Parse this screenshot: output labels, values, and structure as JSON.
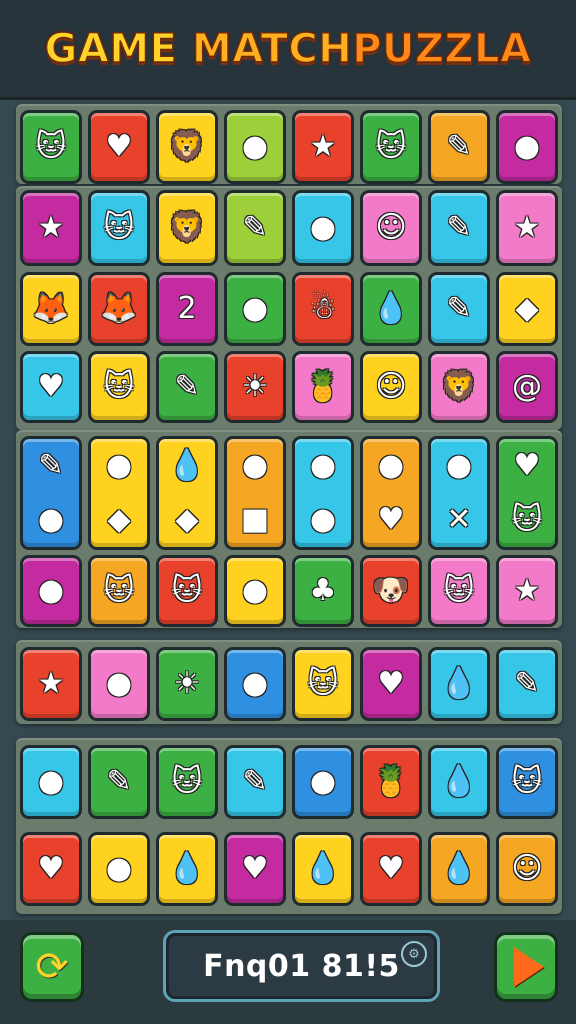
{
  "header": {
    "title_part1": "GAME",
    "title_part2": "MATCH",
    "title_part3": "PUZZLA"
  },
  "colors": {
    "green": "#3cb043",
    "red": "#e8412c",
    "orange": "#f5a623",
    "yellow": "#ffd21f",
    "cyan": "#35c6e8",
    "blue": "#2f8fe0",
    "pink": "#f27ac8",
    "magenta": "#c42ba0",
    "white": "#eef2f0",
    "lime": "#9ccf3a"
  },
  "rows": [
    {
      "tiles": [
        {
          "color": "green",
          "icon": "cat-face-icon",
          "glyph": "🐱"
        },
        {
          "color": "red",
          "icon": "heart-icon",
          "glyph": "♥"
        },
        {
          "color": "yellow",
          "icon": "lion-face-icon",
          "glyph": "🦁"
        },
        {
          "color": "lime",
          "icon": "green-blob-icon",
          "glyph": "●"
        },
        {
          "color": "red",
          "icon": "star-face-icon",
          "glyph": "★"
        },
        {
          "color": "green",
          "icon": "purple-cat-icon",
          "glyph": "🐱"
        },
        {
          "color": "orange",
          "icon": "pencil-icon",
          "glyph": "✎"
        },
        {
          "color": "magenta",
          "icon": "blue-blob-icon",
          "glyph": "●"
        }
      ]
    },
    {
      "tiles": [
        {
          "color": "magenta",
          "icon": "star-face-icon",
          "glyph": "★"
        },
        {
          "color": "cyan",
          "icon": "pink-cat-icon",
          "glyph": "🐱"
        },
        {
          "color": "yellow",
          "icon": "lion-face-icon",
          "glyph": "🦁"
        },
        {
          "color": "lime",
          "icon": "pencil-icon",
          "glyph": "✎"
        },
        {
          "color": "cyan",
          "icon": "lollipop-icon",
          "glyph": "●"
        },
        {
          "color": "pink",
          "icon": "face-with-hat-icon",
          "glyph": "☺"
        },
        {
          "color": "cyan",
          "icon": "pencil-icon",
          "glyph": "✎"
        },
        {
          "color": "pink",
          "icon": "star-face-icon",
          "glyph": "★"
        }
      ]
    },
    {
      "tiles": [
        {
          "color": "yellow",
          "icon": "fox-face-icon",
          "glyph": "🦊"
        },
        {
          "color": "red",
          "icon": "fox-face-icon",
          "glyph": "🦊"
        },
        {
          "color": "magenta",
          "icon": "number-two-icon",
          "glyph": "2"
        },
        {
          "color": "green",
          "icon": "green-blob-icon",
          "glyph": "●"
        },
        {
          "color": "red",
          "icon": "snowman-icon",
          "glyph": "☃"
        },
        {
          "color": "green",
          "icon": "drop-face-icon",
          "glyph": "💧"
        },
        {
          "color": "cyan",
          "icon": "pencil-icon",
          "glyph": "✎"
        },
        {
          "color": "yellow",
          "icon": "diamond-icon",
          "glyph": "◆"
        }
      ]
    },
    {
      "tiles": [
        {
          "color": "cyan",
          "icon": "heart-icon",
          "glyph": "♥"
        },
        {
          "color": "yellow",
          "icon": "green-cat-icon",
          "glyph": "🐱"
        },
        {
          "color": "green",
          "icon": "pencil-icon",
          "glyph": "✎"
        },
        {
          "color": "red",
          "icon": "sun-face-icon",
          "glyph": "☀"
        },
        {
          "color": "pink",
          "icon": "pineapple-icon",
          "glyph": "🍍"
        },
        {
          "color": "yellow",
          "icon": "face-with-hat-icon",
          "glyph": "☺"
        },
        {
          "color": "pink",
          "icon": "lion-face-icon",
          "glyph": "🦁"
        },
        {
          "color": "magenta",
          "icon": "swirl-icon",
          "glyph": "@"
        }
      ]
    },
    {
      "tall": true,
      "tiles": [
        {
          "color": "blue",
          "icon": "pencil-and-blob-icon",
          "glyph": "✎",
          "glyph2": "●"
        },
        {
          "color": "yellow",
          "icon": "blob-and-gem-icon",
          "glyph": "●",
          "glyph2": "◆"
        },
        {
          "color": "yellow",
          "icon": "drop-and-gem-icon",
          "glyph": "💧",
          "glyph2": "◆"
        },
        {
          "color": "orange",
          "icon": "lollipop-and-cube-icon",
          "glyph": "●",
          "glyph2": "■"
        },
        {
          "color": "cyan",
          "icon": "lollipop-and-blob-icon",
          "glyph": "●",
          "glyph2": "●"
        },
        {
          "color": "orange",
          "icon": "lollipop-and-heart-icon",
          "glyph": "●",
          "glyph2": "♥"
        },
        {
          "color": "cyan",
          "icon": "lollipop-and-cross-icon",
          "glyph": "●",
          "glyph2": "✕"
        },
        {
          "color": "green",
          "icon": "heart-and-cat-icon",
          "glyph": "♥",
          "glyph2": "🐱"
        }
      ]
    },
    {
      "tiles": [
        {
          "color": "magenta",
          "icon": "apple-face-icon",
          "glyph": "●"
        },
        {
          "color": "orange",
          "icon": "cat-face-icon",
          "glyph": "🐱"
        },
        {
          "color": "red",
          "icon": "white-cat-icon",
          "glyph": "🐱"
        },
        {
          "color": "yellow",
          "icon": "lollipop-icon",
          "glyph": "●"
        },
        {
          "color": "green",
          "icon": "tree-face-icon",
          "glyph": "♣"
        },
        {
          "color": "red",
          "icon": "dog-face-icon",
          "glyph": "🐶"
        },
        {
          "color": "pink",
          "icon": "cat-face-icon",
          "glyph": "🐱"
        },
        {
          "color": "pink",
          "icon": "star-face-icon",
          "glyph": "★"
        }
      ]
    },
    {
      "tiles": [
        {
          "color": "red",
          "icon": "star-face-icon",
          "glyph": "★"
        },
        {
          "color": "pink",
          "icon": "blue-blob-icon",
          "glyph": "●"
        },
        {
          "color": "green",
          "icon": "sun-face-icon",
          "glyph": "☀"
        },
        {
          "color": "blue",
          "icon": "lollipop-icon",
          "glyph": "●"
        },
        {
          "color": "yellow",
          "icon": "cat-face-icon",
          "glyph": "🐱"
        },
        {
          "color": "magenta",
          "icon": "heart-icon",
          "glyph": "♥"
        },
        {
          "color": "cyan",
          "icon": "drop-face-icon",
          "glyph": "💧"
        },
        {
          "color": "cyan",
          "icon": "pencil-icon",
          "glyph": "✎"
        }
      ]
    },
    {
      "tiles": [
        {
          "color": "cyan",
          "icon": "lollipop-icon",
          "glyph": "●"
        },
        {
          "color": "green",
          "icon": "carrot-icon",
          "glyph": "✎"
        },
        {
          "color": "green",
          "icon": "pink-cat-icon",
          "glyph": "🐱"
        },
        {
          "color": "cyan",
          "icon": "pencil-icon",
          "glyph": "✎"
        },
        {
          "color": "blue",
          "icon": "lollipop-icon",
          "glyph": "●"
        },
        {
          "color": "red",
          "icon": "pineapple-icon",
          "glyph": "🍍"
        },
        {
          "color": "cyan",
          "icon": "drop-face-icon",
          "glyph": "💧"
        },
        {
          "color": "blue",
          "icon": "cat-face-icon",
          "glyph": "🐱"
        }
      ]
    },
    {
      "tiles": [
        {
          "color": "red",
          "icon": "heart-icon",
          "glyph": "♥"
        },
        {
          "color": "yellow",
          "icon": "green-blob-icon",
          "glyph": "●"
        },
        {
          "color": "yellow",
          "icon": "drop-face-icon",
          "glyph": "💧"
        },
        {
          "color": "magenta",
          "icon": "heart-icon",
          "glyph": "♥"
        },
        {
          "color": "yellow",
          "icon": "drop-face-icon",
          "glyph": "💧"
        },
        {
          "color": "red",
          "icon": "heart-icon",
          "glyph": "♥"
        },
        {
          "color": "orange",
          "icon": "drop-face-icon",
          "glyph": "💧"
        },
        {
          "color": "orange",
          "icon": "face-with-hat-icon",
          "glyph": "☺"
        }
      ]
    }
  ],
  "footer": {
    "refresh_icon": "refresh-icon",
    "refresh_glyph": "⟳",
    "score_text": "Fnq01 81!5",
    "score_icon": "settings-icon",
    "score_icon_glyph": "⚙",
    "next_icon": "play-arrow-icon"
  }
}
